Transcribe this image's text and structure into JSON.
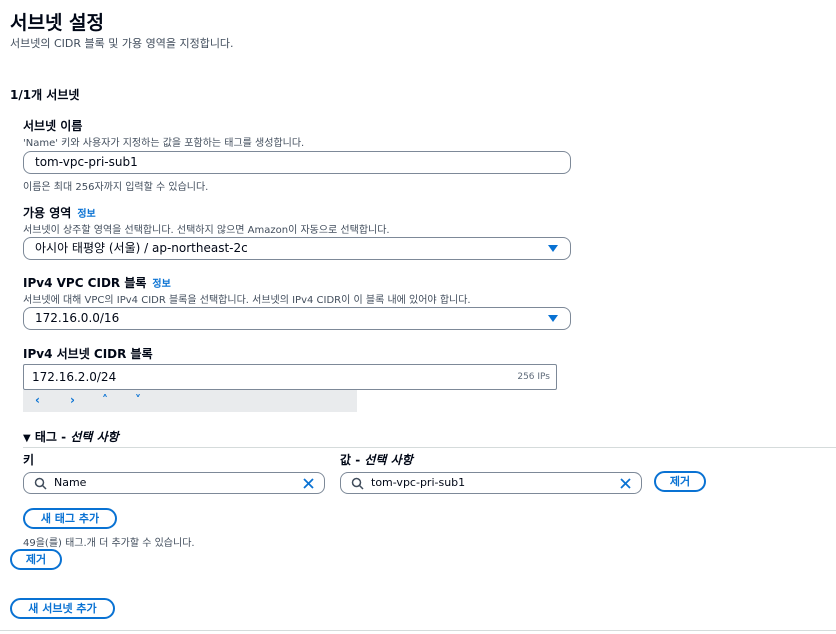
{
  "header": {
    "title": "서브넷 설정",
    "subtitle": "서브넷의 CIDR 블록 및 가용 영역을 지정합니다."
  },
  "subnet": {
    "count_label": "1/1개 서브넷",
    "name": {
      "label": "서브넷 이름",
      "description": "'Name' 키와 사용자가 지정하는 값을 포함하는 태그를 생성합니다.",
      "value": "tom-vpc-pri-sub1",
      "constraint": "이름은 최대 256자까지 입력할 수 있습니다."
    },
    "az": {
      "label": "가용 영역",
      "info": "정보",
      "description": "서브넷이 상주할 영역을 선택합니다. 선택하지 않으면 Amazon이 자동으로 선택합니다.",
      "value": "아시아 태평양 (서울) / ap-northeast-2c"
    },
    "vpc_cidr": {
      "label": "IPv4 VPC CIDR 블록",
      "info": "정보",
      "description": "서브넷에 대해 VPC의 IPv4 CIDR 블록을 선택합니다. 서브넷의 IPv4 CIDR이 이 블록 내에 있어야 합니다.",
      "value": "172.16.0.0/16"
    },
    "subnet_cidr": {
      "label": "IPv4 서브넷 CIDR 블록",
      "value": "172.16.2.0/24",
      "hint": "256 IPs",
      "stepper": [
        "‹",
        "›",
        "˄",
        "˅"
      ]
    }
  },
  "tags": {
    "toggle_label": "태그 - ",
    "toggle_optional": "선택 사항",
    "key_label": "키",
    "value_label": "값 - ",
    "value_optional": "선택 사항",
    "rows": [
      {
        "key": "Name",
        "value": "tom-vpc-pri-sub1",
        "remove": "제거"
      }
    ],
    "add_button": "새 태그 추가",
    "remaining": "49을(를) 태그.개 더 추가할 수 있습니다."
  },
  "actions": {
    "remove_subnet": "제거",
    "add_subnet": "새 서브넷 추가"
  },
  "colors": {
    "accent": "#0972d3",
    "text": "#000716",
    "secondary_text": "#414d5c"
  }
}
